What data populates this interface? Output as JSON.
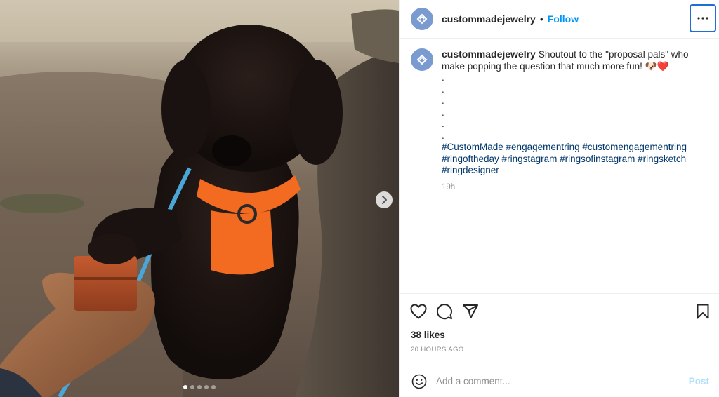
{
  "header": {
    "username": "custommadejewelry",
    "separator": "•",
    "follow_label": "Follow",
    "more_icon": "more-horizontal-icon"
  },
  "caption": {
    "username": "custommadejewelry",
    "text": "Shoutout to the \"proposal pals\" who make popping the question that much more fun! 🐶❤️",
    "dot_lines": [
      ".",
      ".",
      ".",
      ".",
      ".",
      "."
    ],
    "hashtags": "#CustomMade #engagementring #customengagementring #ringoftheday #ringstagram #ringsofinstagram #ringsketch #ringdesigner",
    "time_ago": "19h"
  },
  "actions": {
    "like_icon": "heart-icon",
    "comment_icon": "comment-icon",
    "share_icon": "paper-plane-icon",
    "save_icon": "bookmark-icon"
  },
  "likes": "38 likes",
  "date": "20 HOURS AGO",
  "comment_box": {
    "placeholder": "Add a comment...",
    "post_label": "Post",
    "emoji_icon": "smiley-icon"
  },
  "carousel": {
    "total_slides": 5,
    "active_index": 0
  },
  "colors": {
    "accent": "#0095f6",
    "hashtag": "#00376b",
    "muted": "#8e8e8e",
    "harness": "#f26b21"
  }
}
